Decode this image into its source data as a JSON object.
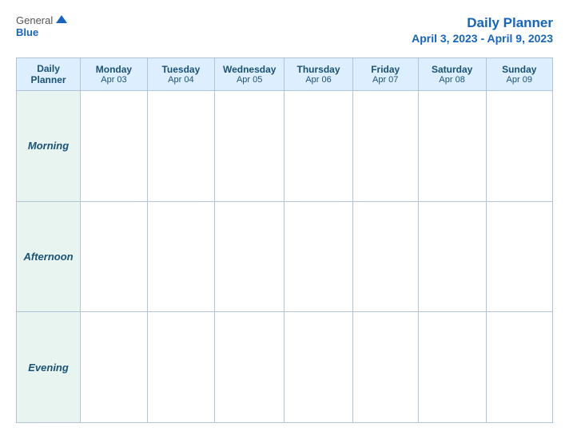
{
  "logo": {
    "general": "General",
    "blue": "Blue"
  },
  "title": {
    "main": "Daily Planner",
    "sub": "April 3, 2023 - April 9, 2023"
  },
  "table": {
    "header_label": "Daily\nPlanner",
    "days": [
      {
        "name": "Monday",
        "date": "Apr 03"
      },
      {
        "name": "Tuesday",
        "date": "Apr 04"
      },
      {
        "name": "Wednesday",
        "date": "Apr 05"
      },
      {
        "name": "Thursday",
        "date": "Apr 06"
      },
      {
        "name": "Friday",
        "date": "Apr 07"
      },
      {
        "name": "Saturday",
        "date": "Apr 08"
      },
      {
        "name": "Sunday",
        "date": "Apr 09"
      }
    ],
    "rows": [
      {
        "label": "Morning"
      },
      {
        "label": "Afternoon"
      },
      {
        "label": "Evening"
      }
    ]
  }
}
